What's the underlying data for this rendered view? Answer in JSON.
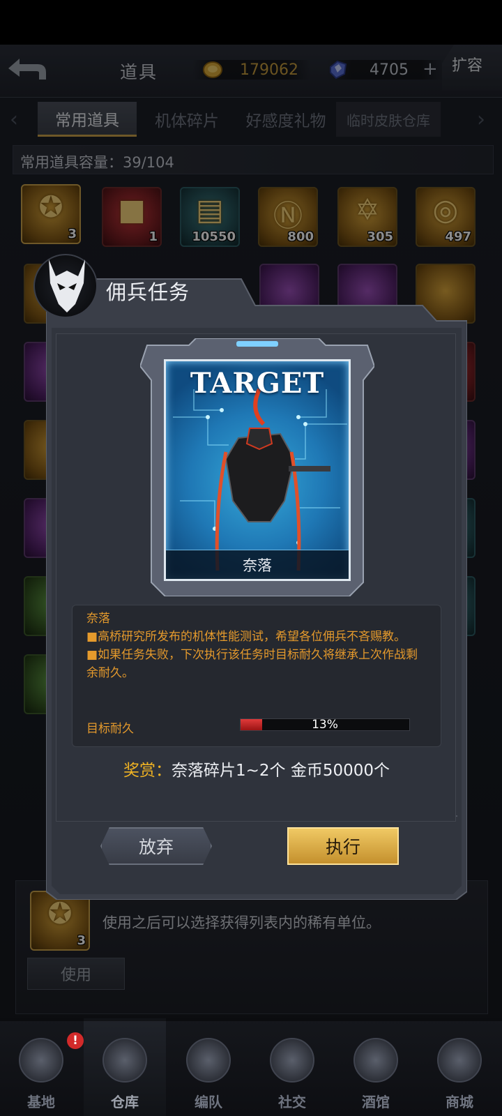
{
  "header": {
    "title": "道具",
    "gold": "179062",
    "gems": "4705",
    "plus": "+",
    "expand_label": "扩容"
  },
  "tabs": [
    {
      "label": "常用道具"
    },
    {
      "label": "机体碎片"
    },
    {
      "label": "好感度礼物"
    },
    {
      "label": "临时皮肤仓库"
    }
  ],
  "capacity": "常用道具容量：39/104",
  "items": [
    {
      "count": "3",
      "icon": "medal-icon"
    },
    {
      "count": "1",
      "icon": "red-crate-icon"
    },
    {
      "count": "10550",
      "icon": "chip-card-icon"
    },
    {
      "count": "800",
      "icon": "n-coin-icon"
    },
    {
      "count": "305",
      "icon": "star-badge-icon"
    },
    {
      "count": "497",
      "icon": "dragon-coin-icon"
    }
  ],
  "detail": {
    "description": "使用之后可以选择获得列表内的稀有单位。",
    "icon_count": "3",
    "use_label": "使用"
  },
  "nav": [
    {
      "label": "基地",
      "badge": "!"
    },
    {
      "label": "仓库"
    },
    {
      "label": "编队"
    },
    {
      "label": "社交"
    },
    {
      "label": "酒馆"
    },
    {
      "label": "商城"
    }
  ],
  "modal": {
    "title": "佣兵任务",
    "card_heading": "TARGET",
    "card_name": "奈落",
    "info_name": "奈落",
    "lines": [
      "■高桥研究所发布的机体性能测试，希望各位佣兵不吝赐教。",
      "■如果任务失败，下次执行该任务时目标耐久将继承上次作战剩余耐久。"
    ],
    "durability_label": "目标耐久",
    "durability_text": "13%",
    "durability_value": 0.13,
    "reward_label": "奖赏：",
    "reward_text": "奈落碎片1~2个 金币50000个",
    "abandon_label": "放弃",
    "execute_label": "执行"
  },
  "colors": {
    "accent_gold": "#f0b323",
    "info_orange": "#e59a2c",
    "durability_red": "#e03a3a"
  }
}
